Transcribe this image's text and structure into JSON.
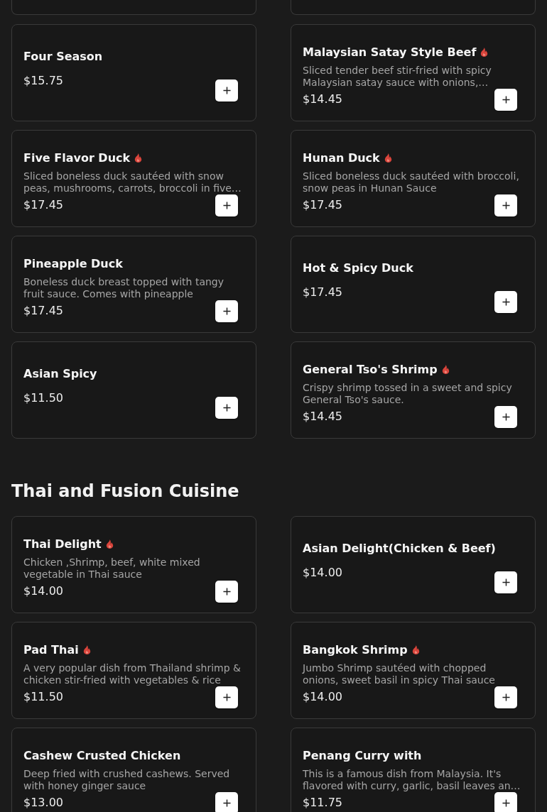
{
  "sections": [
    {
      "items": [
        {
          "name": "Four Season",
          "spicy": false,
          "price": "$15.75"
        },
        {
          "name": "Malaysian Satay Style Beef",
          "spicy": true,
          "description": "Sliced tender beef stir-fried with spicy Malaysian satay sauce with onions,…",
          "price": "$14.45"
        },
        {
          "name": "Five Flavor Duck",
          "spicy": true,
          "description": "Sliced boneless duck sautéed with snow peas, mushrooms, carrots, broccoli in five…",
          "price": "$17.45"
        },
        {
          "name": "Hunan Duck",
          "spicy": true,
          "description": "Sliced boneless duck sautéed with broccoli, snow peas in Hunan Sauce",
          "price": "$17.45"
        },
        {
          "name": "Pineapple Duck",
          "spicy": false,
          "description": "Boneless duck breast topped with tangy fruit sauce. Comes with pineapple",
          "price": "$17.45"
        },
        {
          "name": "Hot & Spicy Duck",
          "spicy": false,
          "price": "$17.45"
        },
        {
          "name": "Asian Spicy",
          "spicy": false,
          "price": "$11.50"
        },
        {
          "name": "General Tso's Shrimp",
          "spicy": true,
          "description": "Crispy shrimp tossed in a sweet and spicy General Tso's sauce.",
          "price": "$14.45"
        }
      ]
    },
    {
      "title": "Thai and Fusion Cuisine",
      "items": [
        {
          "name": "Thai Delight",
          "spicy": true,
          "description": "Chicken ,Shrimp, beef, white mixed vegetable in Thai sauce",
          "price": "$14.00"
        },
        {
          "name": "Asian Delight(Chicken & Beef)",
          "spicy": false,
          "price": "$14.00"
        },
        {
          "name": "Pad Thai",
          "spicy": true,
          "description": "A very popular dish from Thailand shrimp & chicken stir-fried with vegetables & rice",
          "price": "$11.50"
        },
        {
          "name": "Bangkok Shrimp",
          "spicy": true,
          "description": "Jumbo Shrimp sautéed with chopped onions, sweet basil in spicy Thai sauce",
          "price": "$14.00"
        },
        {
          "name": "Cashew Crusted Chicken",
          "spicy": false,
          "description": "Deep fried with crushed cashews. Served with honey ginger sauce",
          "price": "$13.00"
        },
        {
          "name": "Penang Curry with",
          "spicy": false,
          "description": "This is a famous dish from Malaysia. It's flavored with curry, garlic, basil leaves an…",
          "price": "$11.75"
        }
      ]
    }
  ]
}
